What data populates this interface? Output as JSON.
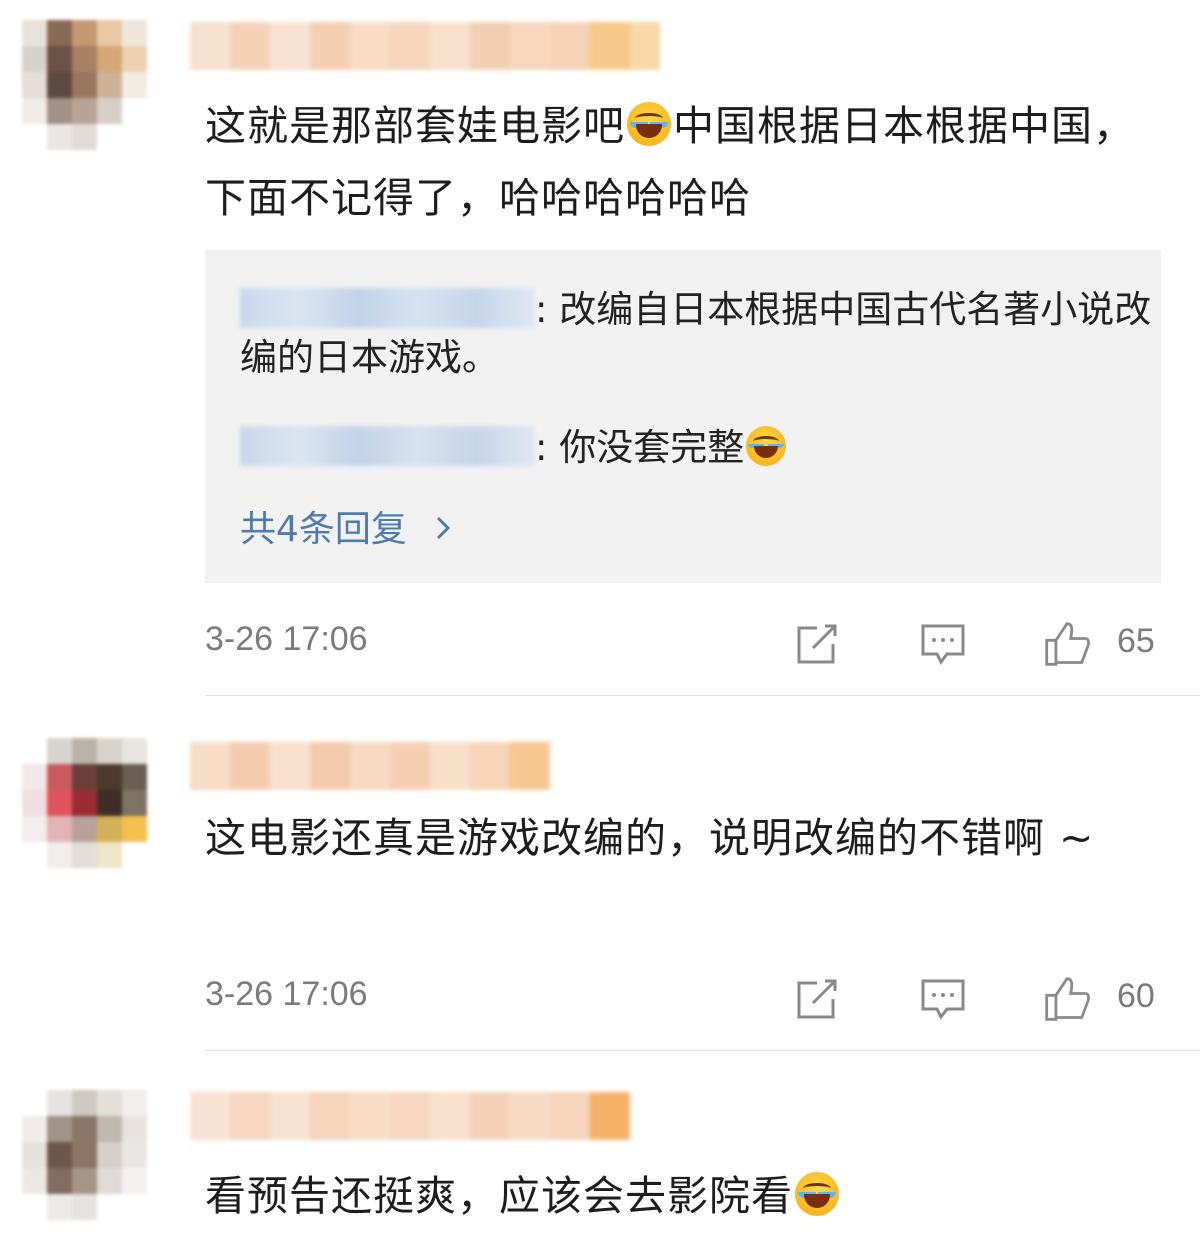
{
  "comments": [
    {
      "text": "这就是那部套娃电影吧",
      "text_after_emoji": "中国根据日本根据中国，下面不记得了，哈哈哈哈哈哈",
      "replies": [
        {
          "text": ": 改编自日本根据中国古代名著小说改编的日本游戏。"
        },
        {
          "text": ": 你没套完整"
        }
      ],
      "more_replies": "共4条回复",
      "time": "3-26 17:06",
      "likes": "65"
    },
    {
      "text": "这电影还真是游戏改编的，说明改编的不错啊 ~",
      "time": "3-26 17:06",
      "likes": "60"
    },
    {
      "text": "看预告还挺爽，应该会去影院看"
    }
  ],
  "icons": {
    "emoji": "laugh-cry-emoji-icon",
    "share": "share-icon",
    "comment": "comment-icon",
    "like": "thumbs-up-icon",
    "chevron": "chevron-right-icon"
  },
  "colors": {
    "link_blue": "#4f7cae",
    "meta_gray": "#7b7b7b",
    "reply_bg": "#f2f2f2"
  }
}
